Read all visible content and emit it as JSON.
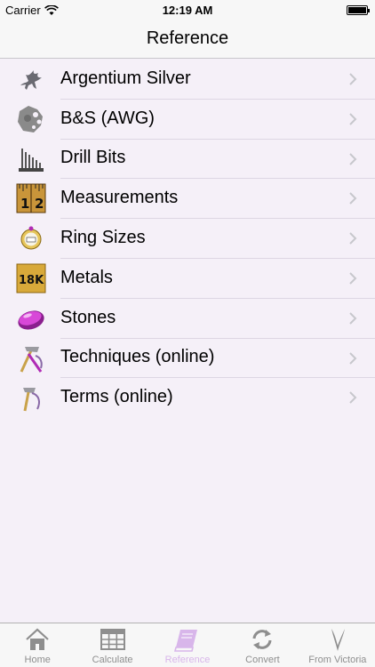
{
  "status_bar": {
    "carrier": "Carrier",
    "time": "12:19 AM"
  },
  "nav": {
    "title": "Reference"
  },
  "items": [
    {
      "label": "Argentium Silver",
      "icon": "pegasus-icon"
    },
    {
      "label": "B&S (AWG)",
      "icon": "wire-gauge-icon"
    },
    {
      "label": "Drill Bits",
      "icon": "drill-bits-icon"
    },
    {
      "label": "Measurements",
      "icon": "ruler-icon"
    },
    {
      "label": "Ring Sizes",
      "icon": "ring-icon"
    },
    {
      "label": "Metals",
      "icon": "gold-18k-icon"
    },
    {
      "label": "Stones",
      "icon": "stone-icon"
    },
    {
      "label": "Techniques (online)",
      "icon": "tools-icon"
    },
    {
      "label": "Terms (online)",
      "icon": "terms-icon"
    }
  ],
  "tabs": [
    {
      "label": "Home",
      "icon": "home-icon",
      "active": false
    },
    {
      "label": "Calculate",
      "icon": "grid-icon",
      "active": false
    },
    {
      "label": "Reference",
      "icon": "book-icon",
      "active": true
    },
    {
      "label": "Convert",
      "icon": "refresh-icon",
      "active": false
    },
    {
      "label": "From Victoria",
      "icon": "v-logo-icon",
      "active": false
    }
  ],
  "colors": {
    "background": "#f5f0f8",
    "accent_active_tab": "#d8b6ea",
    "inactive_tab": "#8e8e8e",
    "gold": "#d8a93a",
    "purple": "#b02bb5"
  }
}
